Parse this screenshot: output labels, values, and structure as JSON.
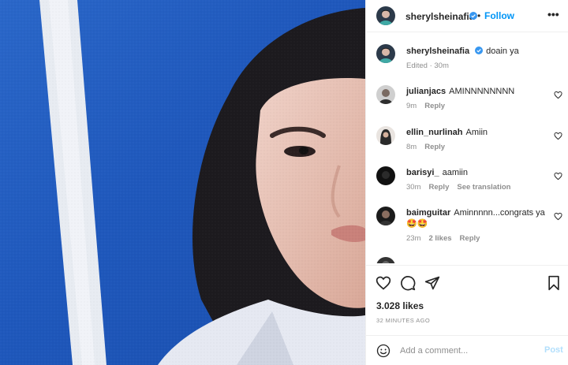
{
  "post": {
    "username": "sherylsheinafia",
    "follow_label": "Follow",
    "separator": "•",
    "more_label": "•••",
    "caption": "doain ya",
    "caption_meta": "Edited · 30m"
  },
  "comments": [
    {
      "username": "julianjacs",
      "text": "AMINNNNNNNN",
      "time": "9m",
      "reply": "Reply"
    },
    {
      "username": "ellin_nurlinah",
      "text": "Amiin",
      "time": "8m",
      "reply": "Reply"
    },
    {
      "username": "barisyi_",
      "text": "aamiin",
      "time": "30m",
      "reply": "Reply",
      "translate": "See translation"
    },
    {
      "username": "baimguitar",
      "text": "Aminnnnn...congrats ya",
      "emoji": "🤩🤩",
      "time": "23m",
      "likes": "2 likes",
      "reply": "Reply"
    }
  ],
  "stats": {
    "likes": "3.028 likes",
    "time_ago": "32 MINUTES AGO"
  },
  "add_comment": {
    "placeholder": "Add a comment...",
    "post_label": "Post"
  },
  "icons": {
    "like": "heart-icon",
    "comment": "comment-icon",
    "share": "paper-plane-icon",
    "save": "bookmark-icon",
    "verified": "verified-badge-icon",
    "emoji": "smiley-icon"
  },
  "colors": {
    "accent": "#0095f6",
    "verified": "#3897f0",
    "muted": "#8e8e8e",
    "post_disabled": "#b2dffc",
    "photo_background": "#2262c4"
  }
}
